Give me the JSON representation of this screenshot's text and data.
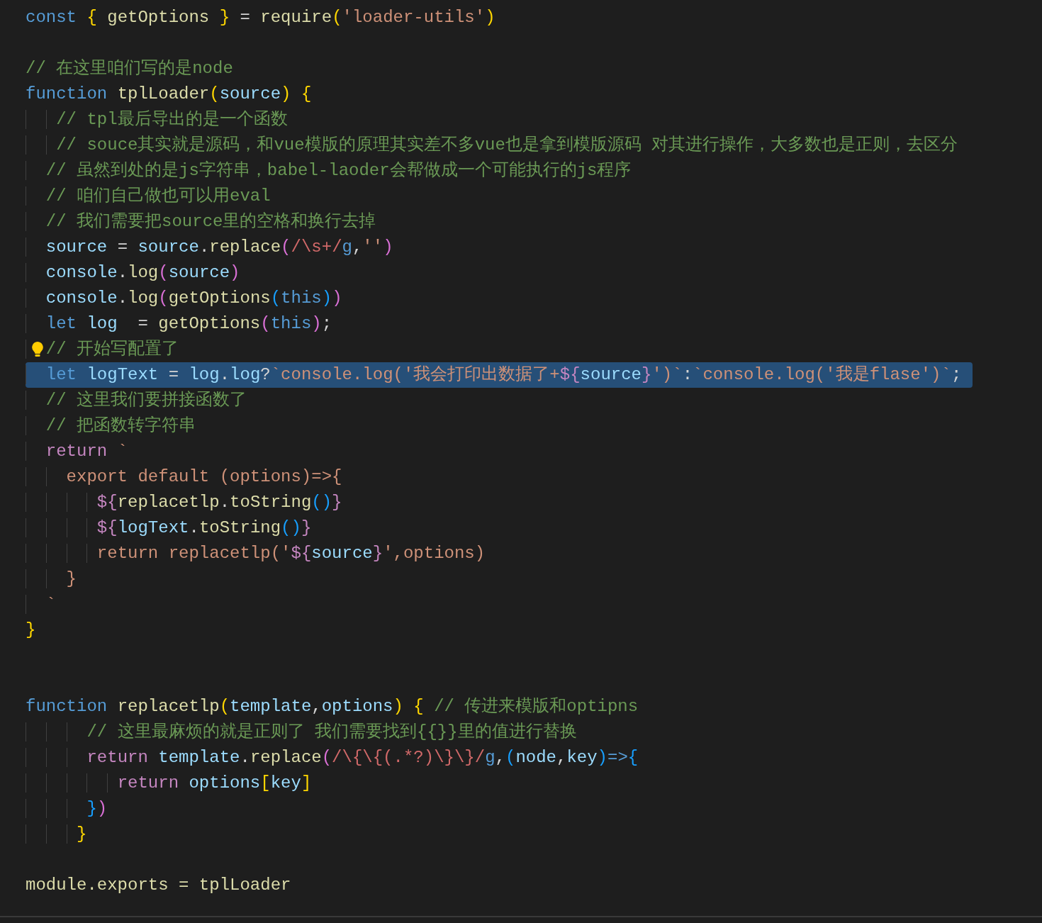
{
  "editor": {
    "lines": [
      {
        "kind": "code",
        "selected": false,
        "lightbulb": false,
        "tokens": [
          {
            "kind": "keyword",
            "text": "const "
          },
          {
            "kind": "brace",
            "text": "{ "
          },
          {
            "kind": "function",
            "text": "getOptions"
          },
          {
            "kind": "brace",
            "text": " }"
          },
          {
            "kind": "plain",
            "text": " = "
          },
          {
            "kind": "function",
            "text": "require"
          },
          {
            "kind": "brace",
            "text": "("
          },
          {
            "kind": "string",
            "text": "'loader-utils'"
          },
          {
            "kind": "brace",
            "text": ")"
          }
        ]
      },
      {
        "kind": "blank"
      },
      {
        "kind": "code",
        "selected": false,
        "lightbulb": false,
        "tokens": [
          {
            "kind": "comment",
            "text": "// 在这里咱们写的是node"
          }
        ]
      },
      {
        "kind": "code",
        "selected": false,
        "lightbulb": false,
        "tokens": [
          {
            "kind": "keyword",
            "text": "function "
          },
          {
            "kind": "function",
            "text": "tplLoader"
          },
          {
            "kind": "brace",
            "text": "("
          },
          {
            "kind": "variable",
            "text": "source"
          },
          {
            "kind": "brace",
            "text": ") {"
          }
        ]
      },
      {
        "kind": "code",
        "selected": false,
        "lightbulb": false,
        "tokens": [
          {
            "kind": "comment",
            "text": "   // tpl最后导出的是一个函数"
          }
        ]
      },
      {
        "kind": "code",
        "selected": false,
        "lightbulb": false,
        "tokens": [
          {
            "kind": "comment",
            "text": "   // souce其实就是源码，和vue模版的原理其实差不多vue也是拿到模版源码 对其进行操作，大多数也是正则，去区分"
          }
        ]
      },
      {
        "kind": "code",
        "selected": false,
        "lightbulb": false,
        "tokens": [
          {
            "kind": "comment",
            "text": "  // 虽然到处的是js字符串，babel-laoder会帮做成一个可能执行的js程序"
          }
        ]
      },
      {
        "kind": "code",
        "selected": false,
        "lightbulb": false,
        "tokens": [
          {
            "kind": "comment",
            "text": "  // 咱们自己做也可以用eval"
          }
        ]
      },
      {
        "kind": "code",
        "selected": false,
        "lightbulb": false,
        "tokens": [
          {
            "kind": "comment",
            "text": "  // 我们需要把source里的空格和换行去掉"
          }
        ]
      },
      {
        "kind": "code",
        "selected": false,
        "lightbulb": false,
        "tokens": [
          {
            "kind": "variable",
            "text": "  source"
          },
          {
            "kind": "plain",
            "text": " = "
          },
          {
            "kind": "variable",
            "text": "source"
          },
          {
            "kind": "plain",
            "text": "."
          },
          {
            "kind": "function",
            "text": "replace"
          },
          {
            "kind": "paren",
            "text": "("
          },
          {
            "kind": "regex",
            "text": "/\\s+/"
          },
          {
            "kind": "keyword",
            "text": "g"
          },
          {
            "kind": "plain",
            "text": ","
          },
          {
            "kind": "string",
            "text": "''"
          },
          {
            "kind": "paren",
            "text": ")"
          }
        ]
      },
      {
        "kind": "code",
        "selected": false,
        "lightbulb": false,
        "tokens": [
          {
            "kind": "variable",
            "text": "  console"
          },
          {
            "kind": "plain",
            "text": "."
          },
          {
            "kind": "function",
            "text": "log"
          },
          {
            "kind": "paren",
            "text": "("
          },
          {
            "kind": "variable",
            "text": "source"
          },
          {
            "kind": "paren",
            "text": ")"
          }
        ]
      },
      {
        "kind": "code",
        "selected": false,
        "lightbulb": false,
        "tokens": [
          {
            "kind": "variable",
            "text": "  console"
          },
          {
            "kind": "plain",
            "text": "."
          },
          {
            "kind": "function",
            "text": "log"
          },
          {
            "kind": "paren",
            "text": "("
          },
          {
            "kind": "function",
            "text": "getOptions"
          },
          {
            "kind": "bracket",
            "text": "("
          },
          {
            "kind": "keyword",
            "text": "this"
          },
          {
            "kind": "bracket",
            "text": ")"
          },
          {
            "kind": "paren",
            "text": ")"
          }
        ]
      },
      {
        "kind": "code",
        "selected": false,
        "lightbulb": false,
        "tokens": [
          {
            "kind": "keyword",
            "text": "  let "
          },
          {
            "kind": "variable",
            "text": "log"
          },
          {
            "kind": "plain",
            "text": "  = "
          },
          {
            "kind": "function",
            "text": "getOptions"
          },
          {
            "kind": "paren",
            "text": "("
          },
          {
            "kind": "keyword",
            "text": "this"
          },
          {
            "kind": "paren",
            "text": ")"
          },
          {
            "kind": "plain",
            "text": ";"
          }
        ]
      },
      {
        "kind": "code",
        "selected": false,
        "lightbulb": true,
        "tokens": [
          {
            "kind": "comment",
            "text": "  // 开始写配置了"
          }
        ]
      },
      {
        "kind": "code",
        "selected": true,
        "lightbulb": false,
        "tokens": [
          {
            "kind": "keyword",
            "text": "  let "
          },
          {
            "kind": "variable",
            "text": "logText"
          },
          {
            "kind": "plain",
            "text": " = "
          },
          {
            "kind": "variable",
            "text": "log"
          },
          {
            "kind": "plain",
            "text": "."
          },
          {
            "kind": "variable",
            "text": "log"
          },
          {
            "kind": "plain",
            "text": "?"
          },
          {
            "kind": "string",
            "text": "`console.log('我会打印出数据了+"
          },
          {
            "kind": "template",
            "text": "${"
          },
          {
            "kind": "variable",
            "text": "source"
          },
          {
            "kind": "template",
            "text": "}"
          },
          {
            "kind": "string",
            "text": "')`"
          },
          {
            "kind": "plain",
            "text": ":"
          },
          {
            "kind": "string",
            "text": "`console.log('我是flase')`"
          },
          {
            "kind": "plain",
            "text": ";"
          }
        ]
      },
      {
        "kind": "code",
        "selected": false,
        "lightbulb": false,
        "tokens": [
          {
            "kind": "comment",
            "text": "  // 这里我们要拼接函数了"
          }
        ]
      },
      {
        "kind": "code",
        "selected": false,
        "lightbulb": false,
        "tokens": [
          {
            "kind": "comment",
            "text": "  // 把函数转字符串"
          }
        ]
      },
      {
        "kind": "code",
        "selected": false,
        "lightbulb": false,
        "tokens": [
          {
            "kind": "control",
            "text": "  return "
          },
          {
            "kind": "string",
            "text": "`"
          }
        ]
      },
      {
        "kind": "code",
        "selected": false,
        "lightbulb": false,
        "tokens": [
          {
            "kind": "string",
            "text": "    export default (options)=>{"
          }
        ]
      },
      {
        "kind": "code",
        "selected": false,
        "lightbulb": false,
        "tokens": [
          {
            "kind": "template",
            "text": "       ${"
          },
          {
            "kind": "function",
            "text": "replacetlp"
          },
          {
            "kind": "plain",
            "text": "."
          },
          {
            "kind": "function",
            "text": "toString"
          },
          {
            "kind": "bracket",
            "text": "()"
          },
          {
            "kind": "template",
            "text": "}"
          }
        ]
      },
      {
        "kind": "code",
        "selected": false,
        "lightbulb": false,
        "tokens": [
          {
            "kind": "template",
            "text": "       ${"
          },
          {
            "kind": "variable",
            "text": "logText"
          },
          {
            "kind": "plain",
            "text": "."
          },
          {
            "kind": "function",
            "text": "toString"
          },
          {
            "kind": "bracket",
            "text": "()"
          },
          {
            "kind": "template",
            "text": "}"
          }
        ]
      },
      {
        "kind": "code",
        "selected": false,
        "lightbulb": false,
        "tokens": [
          {
            "kind": "string",
            "text": "       return replacetlp('"
          },
          {
            "kind": "template",
            "text": "${"
          },
          {
            "kind": "variable",
            "text": "source"
          },
          {
            "kind": "template",
            "text": "}"
          },
          {
            "kind": "string",
            "text": "',options)"
          }
        ]
      },
      {
        "kind": "code",
        "selected": false,
        "lightbulb": false,
        "tokens": [
          {
            "kind": "string",
            "text": "    }"
          }
        ]
      },
      {
        "kind": "code",
        "selected": false,
        "lightbulb": false,
        "tokens": [
          {
            "kind": "string",
            "text": "  `"
          }
        ]
      },
      {
        "kind": "code",
        "selected": false,
        "lightbulb": false,
        "tokens": [
          {
            "kind": "brace",
            "text": "}"
          }
        ]
      },
      {
        "kind": "blank"
      },
      {
        "kind": "blank"
      },
      {
        "kind": "code",
        "selected": false,
        "lightbulb": false,
        "tokens": [
          {
            "kind": "keyword",
            "text": "function "
          },
          {
            "kind": "function",
            "text": "replacetlp"
          },
          {
            "kind": "brace",
            "text": "("
          },
          {
            "kind": "variable",
            "text": "template"
          },
          {
            "kind": "plain",
            "text": ","
          },
          {
            "kind": "variable",
            "text": "options"
          },
          {
            "kind": "brace",
            "text": ") {"
          },
          {
            "kind": "comment",
            "text": " // 传进来模版和optipns"
          }
        ]
      },
      {
        "kind": "code",
        "selected": false,
        "lightbulb": false,
        "tokens": [
          {
            "kind": "comment",
            "text": "      // 这里最麻烦的就是正则了 我们需要找到{{}}里的值进行替换"
          }
        ]
      },
      {
        "kind": "code",
        "selected": false,
        "lightbulb": false,
        "tokens": [
          {
            "kind": "control",
            "text": "      return "
          },
          {
            "kind": "variable",
            "text": "template"
          },
          {
            "kind": "plain",
            "text": "."
          },
          {
            "kind": "function",
            "text": "replace"
          },
          {
            "kind": "paren",
            "text": "("
          },
          {
            "kind": "regex",
            "text": "/\\{\\{(.*?)\\}\\}/"
          },
          {
            "kind": "keyword",
            "text": "g"
          },
          {
            "kind": "plain",
            "text": ","
          },
          {
            "kind": "bracket",
            "text": "("
          },
          {
            "kind": "variable",
            "text": "node"
          },
          {
            "kind": "plain",
            "text": ","
          },
          {
            "kind": "variable",
            "text": "key"
          },
          {
            "kind": "bracket",
            "text": ")"
          },
          {
            "kind": "keyword",
            "text": "=>"
          },
          {
            "kind": "bracket",
            "text": "{"
          }
        ]
      },
      {
        "kind": "code",
        "selected": false,
        "lightbulb": false,
        "tokens": [
          {
            "kind": "control",
            "text": "         return "
          },
          {
            "kind": "variable",
            "text": "options"
          },
          {
            "kind": "brace",
            "text": "["
          },
          {
            "kind": "variable",
            "text": "key"
          },
          {
            "kind": "brace",
            "text": "]"
          }
        ]
      },
      {
        "kind": "code",
        "selected": false,
        "lightbulb": false,
        "tokens": [
          {
            "kind": "bracket",
            "text": "      }"
          },
          {
            "kind": "paren",
            "text": ")"
          }
        ]
      },
      {
        "kind": "code",
        "selected": false,
        "lightbulb": false,
        "tokens": [
          {
            "kind": "brace",
            "text": "     }"
          }
        ]
      },
      {
        "kind": "blank"
      },
      {
        "kind": "code",
        "selected": false,
        "lightbulb": false,
        "tokens": [
          {
            "kind": "function",
            "text": "module.exports = tplLoader"
          }
        ]
      }
    ]
  }
}
